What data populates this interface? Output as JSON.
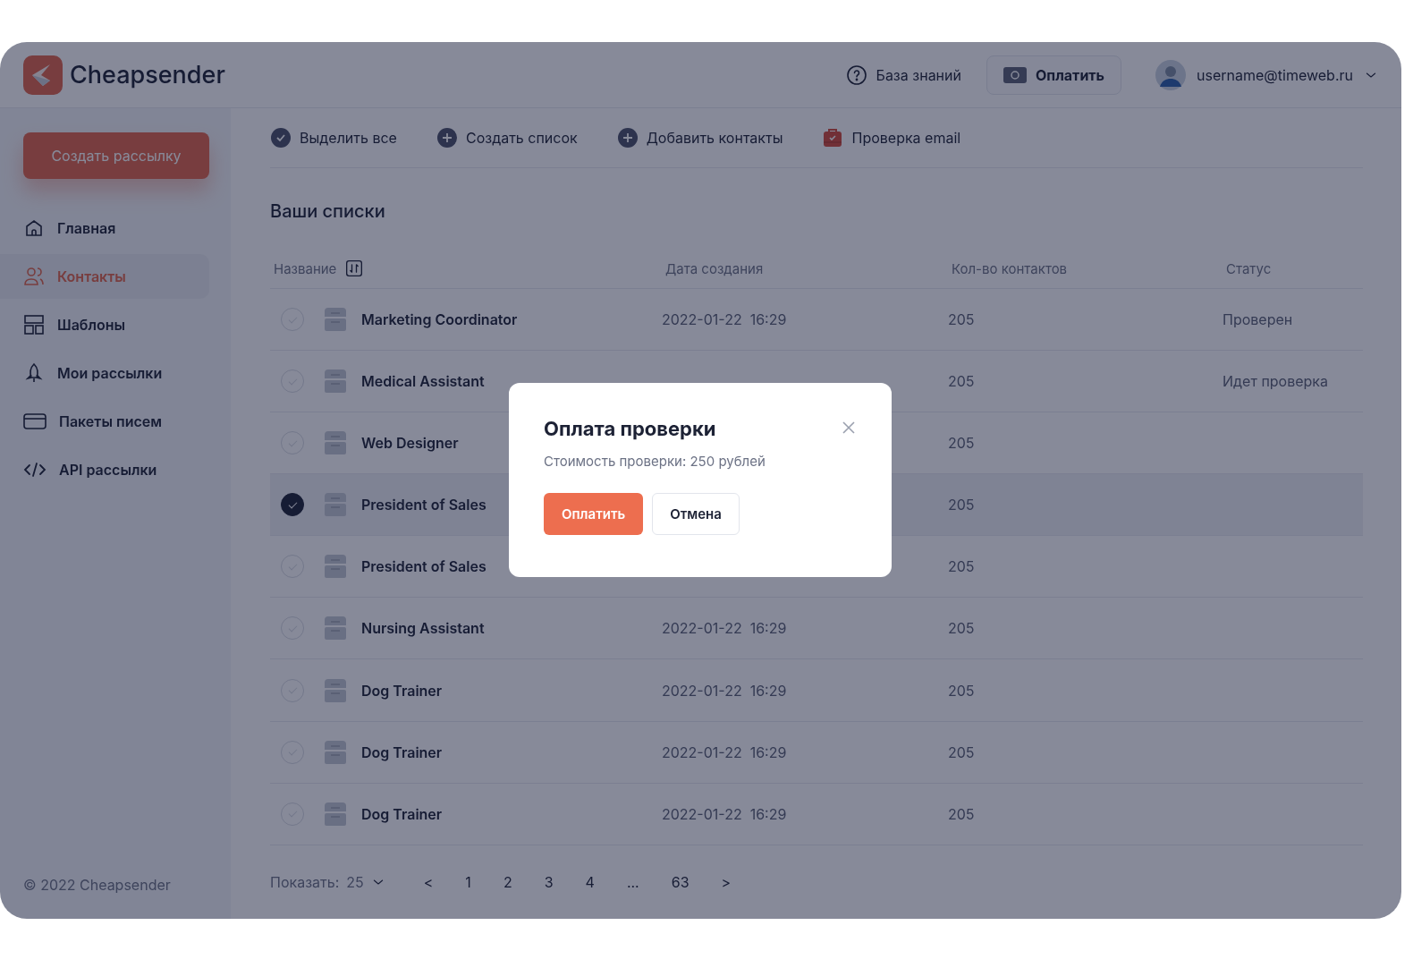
{
  "header": {
    "logo": "Cheapsender",
    "help": "База знаний",
    "pay": "Оплатить",
    "user": "username@timeweb.ru"
  },
  "sidebar": {
    "create_button": "Создать рассылку",
    "items": [
      {
        "label": "Главная",
        "kind": "home",
        "selected": false
      },
      {
        "label": "Контакты",
        "kind": "users",
        "selected": true
      },
      {
        "label": "Шаблоны",
        "kind": "layout",
        "selected": false
      },
      {
        "label": "Мои рассылки",
        "kind": "rocket",
        "selected": false
      },
      {
        "label": "Пакеты писем",
        "kind": "card",
        "selected": false
      },
      {
        "label": "API рассылки",
        "kind": "code",
        "selected": false
      }
    ],
    "footer": "© 2022 Cheapsender"
  },
  "toolbar": [
    {
      "label": "Выделить все",
      "kind": "check"
    },
    {
      "label": "Создать список",
      "kind": "plus"
    },
    {
      "label": "Добавить контакты",
      "kind": "plus"
    },
    {
      "label": "Проверка email",
      "kind": "verify"
    }
  ],
  "list_title": "Ваши списки",
  "table": {
    "columns": [
      "Название",
      "Дата создания",
      "Кол-во контактов",
      "Статус"
    ],
    "rows": [
      {
        "name": "Marketing Coordinator",
        "date": "2022-01-22  16:29",
        "count": "205",
        "status": "Проверен",
        "selected": false
      },
      {
        "name": "Medical Assistant",
        "count": "205",
        "status": "Идет проверка",
        "selected": false
      },
      {
        "name": "Web Designer",
        "count": "205",
        "selected": false
      },
      {
        "name": "President of Sales",
        "count": "205",
        "selected": true
      },
      {
        "name": "President of Sales",
        "count": "205",
        "selected": false
      },
      {
        "name": "Nursing Assistant",
        "date": "2022-01-22  16:29",
        "count": "205",
        "selected": false
      },
      {
        "name": "Dog Trainer",
        "date": "2022-01-22  16:29",
        "count": "205",
        "selected": false
      },
      {
        "name": "Dog Trainer",
        "date": "2022-01-22  16:29",
        "count": "205",
        "selected": false
      },
      {
        "name": "Dog Trainer",
        "date": "2022-01-22  16:29",
        "count": "205",
        "selected": false
      }
    ]
  },
  "pagination": {
    "label": "Показать:",
    "page_size": "25",
    "prev": "<",
    "pages": [
      "1",
      "2",
      "3",
      "4",
      "...",
      "63"
    ],
    "next": ">"
  },
  "dialog": {
    "title": "Оплата проверки",
    "text": "Стоимость проверки: 250 рублей",
    "confirm": "Оплатить",
    "cancel": "Отмена"
  }
}
